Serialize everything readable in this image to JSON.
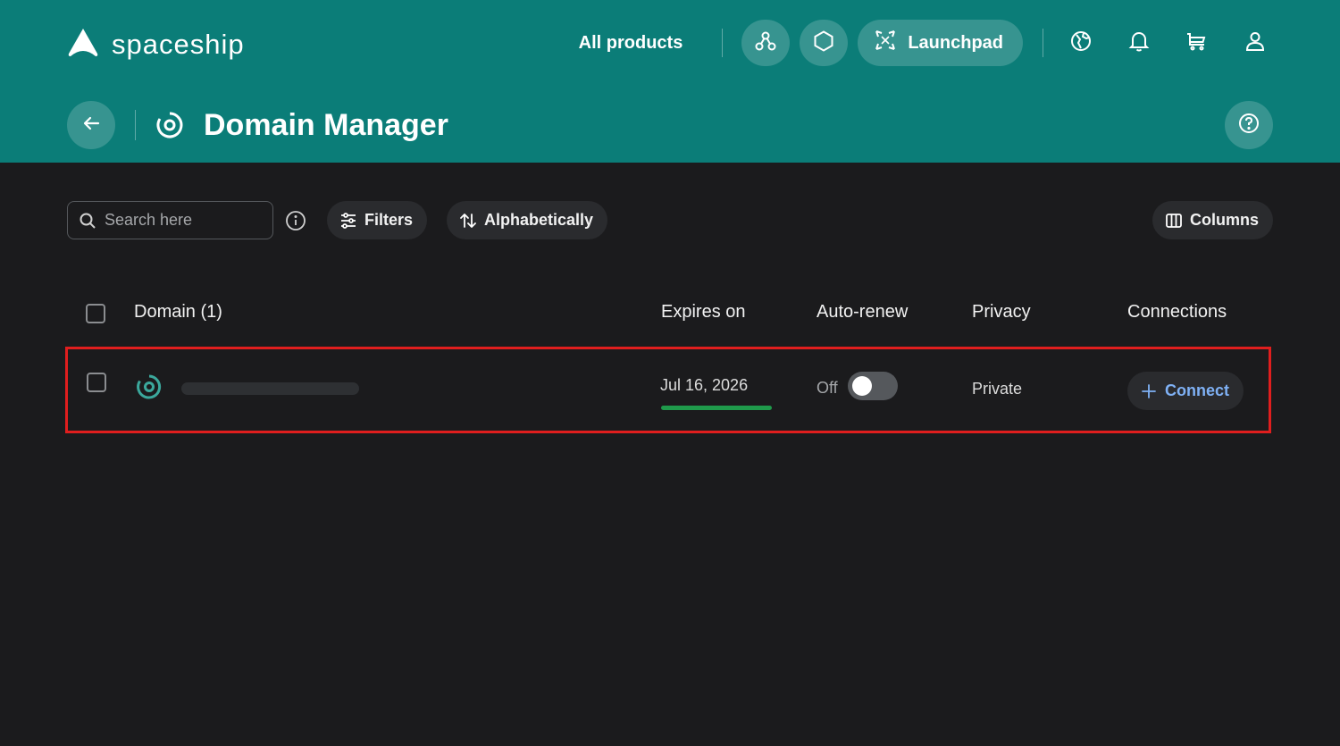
{
  "brand": {
    "name": "spaceship"
  },
  "nav": {
    "all_products": "All products",
    "launchpad": "Launchpad"
  },
  "page": {
    "title": "Domain Manager"
  },
  "toolbar": {
    "search_placeholder": "Search here",
    "filters": "Filters",
    "sort": "Alphabetically",
    "columns": "Columns"
  },
  "table": {
    "headers": {
      "domain": "Domain (1)",
      "expires": "Expires on",
      "autorenew": "Auto-renew",
      "privacy": "Privacy",
      "connections": "Connections"
    },
    "rows": [
      {
        "domain": "",
        "expires": "Jul 16, 2026",
        "autorenew_label": "Off",
        "autorenew_on": false,
        "privacy": "Private",
        "connect": "Connect"
      }
    ]
  },
  "colors": {
    "header_bg": "#0b7d78",
    "page_bg": "#1b1b1d",
    "accent_link": "#7fb1f5",
    "expiry_bar": "#1f9a4b",
    "highlight_border": "#e01e1e"
  },
  "icons": [
    "spaceship-logo-icon",
    "network-icon",
    "hexagon-icon",
    "launchpad-icon",
    "globe-icon",
    "bell-icon",
    "cart-icon",
    "user-icon",
    "back-arrow-icon",
    "domain-target-icon",
    "help-icon",
    "search-icon",
    "info-icon",
    "filters-icon",
    "sort-icon",
    "columns-icon",
    "plus-icon"
  ]
}
